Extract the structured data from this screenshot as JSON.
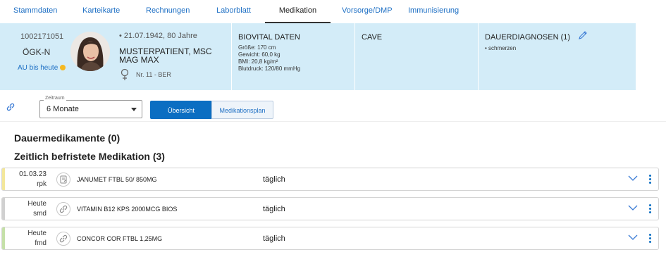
{
  "tabs": [
    {
      "label": "Stammdaten",
      "active": false
    },
    {
      "label": "Karteikarte",
      "active": false
    },
    {
      "label": "Rechnungen",
      "active": false
    },
    {
      "label": "Laborblatt",
      "active": false
    },
    {
      "label": "Medikation",
      "active": true
    },
    {
      "label": "Vorsorge/DMP",
      "active": false
    },
    {
      "label": "Immunisierung",
      "active": false
    }
  ],
  "patient": {
    "id": "1002171051",
    "insurance": "ÖGK-N",
    "au_label": "AU bis heute",
    "dob": "• 21.07.1942, 80 Jahre",
    "name": "MUSTERPATIENT, MSC MAG MAX",
    "ward": "Nr. 11 - BER",
    "gender_icon": "female-icon"
  },
  "vitals": {
    "title": "BIOVITAL DATEN",
    "lines": [
      "Größe: 170 cm",
      "Gewicht: 60,0 kg",
      "BMI: 20,8 kg/m²",
      "Blutdruck: 120/80 mmHg"
    ]
  },
  "cave": {
    "title": "CAVE"
  },
  "diagnoses": {
    "title": "DAUERDIAGNOSEN (1)",
    "items": [
      "• schmerzen"
    ]
  },
  "controls": {
    "period_label": "Zeitraum",
    "period_value": "6 Monate",
    "btn_overview": "Übersicht",
    "btn_plan": "Medikationsplan"
  },
  "sections": {
    "permanent": "Dauermedikamente (0)",
    "temporary": "Zeitlich befristete Medikation (3)"
  },
  "medications": [
    {
      "date": "01.03.23",
      "who": "rpk",
      "name": "JANUMET FTBL 50/ 850MG",
      "freq": "täglich",
      "color": "#f3e79a",
      "icon": "prescription-icon"
    },
    {
      "date": "Heute",
      "who": "smd",
      "name": "VITAMIN B12 KPS 2000MCG BIOS",
      "freq": "täglich",
      "color": "#d0d0d0",
      "icon": "link-icon"
    },
    {
      "date": "Heute",
      "who": "fmd",
      "name": "CONCOR COR FTBL 1,25MG",
      "freq": "täglich",
      "color": "#c5e0a8",
      "icon": "link-icon"
    }
  ],
  "colors": {
    "accent": "#0b6ec2",
    "header_bg": "#d3ecf8",
    "au_dot": "#f5b820"
  }
}
